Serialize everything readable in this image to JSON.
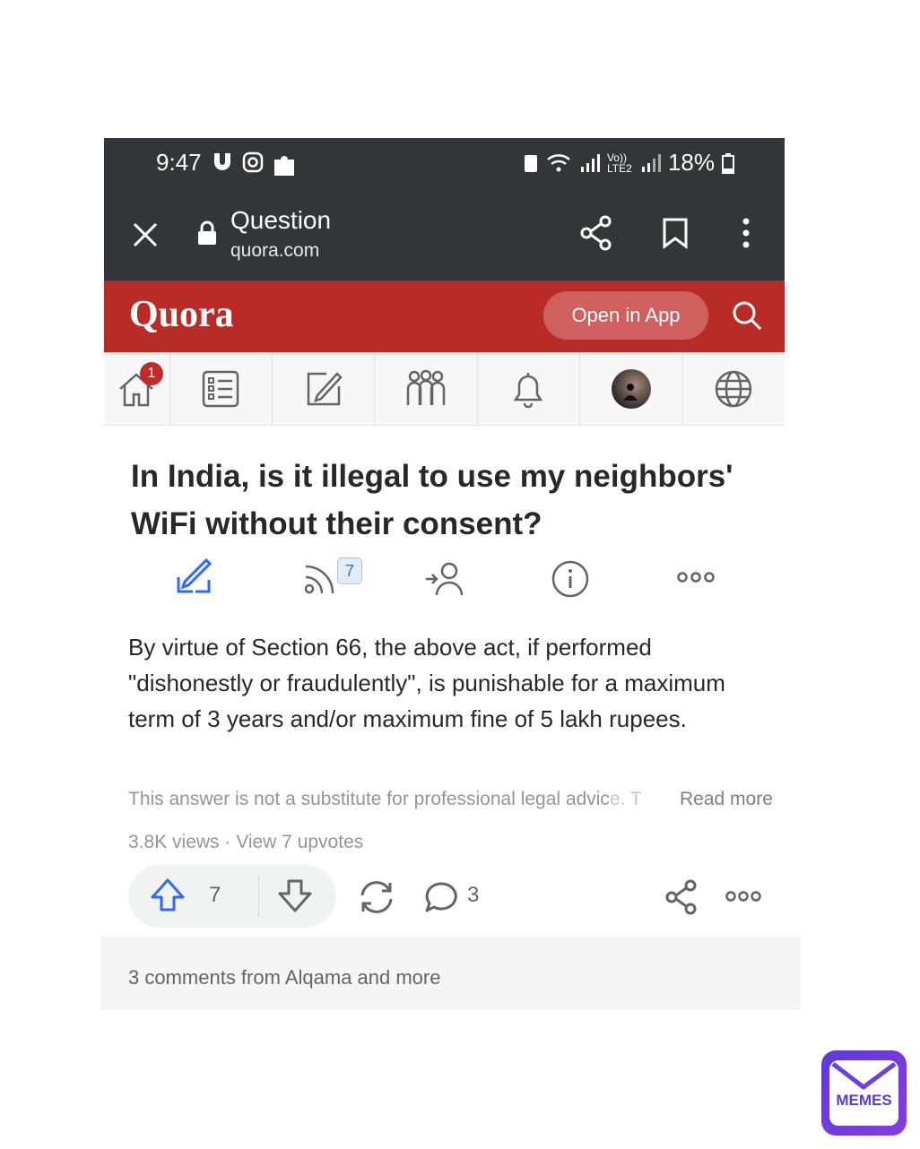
{
  "status_bar": {
    "time": "9:47",
    "signal_label": "Vo)) LTE2",
    "battery": "18%"
  },
  "browser": {
    "title": "Question",
    "url": "quora.com"
  },
  "quora_header": {
    "logo": "Quora",
    "open_in_app": "Open in App"
  },
  "nav": {
    "home_badge": "1"
  },
  "question": {
    "title": "In India, is it illegal to use my neighbors' WiFi without their consent?",
    "follow_count": "7"
  },
  "answer": {
    "body": "By virtue of Section 66, the above act, if performed \"dishonestly or fraudulently\", is punishable for a maximum term of 3 years and/or maximum fine of 5 lakh rupees.",
    "disclaimer": "This answer is not a substitute for professional legal advic",
    "disclaimer_fade": "e. T",
    "read_more": "Read more",
    "meta": "3.8K views · View 7 upvotes",
    "upvotes": "7",
    "comment_count": "3"
  },
  "comments_bar": {
    "text": "3 comments from Alqama and more"
  },
  "watermark": {
    "text": "MEMES"
  },
  "colors": {
    "quora_red": "#b92b27",
    "chrome_dark": "#333538",
    "link_blue": "#2e69ff"
  }
}
